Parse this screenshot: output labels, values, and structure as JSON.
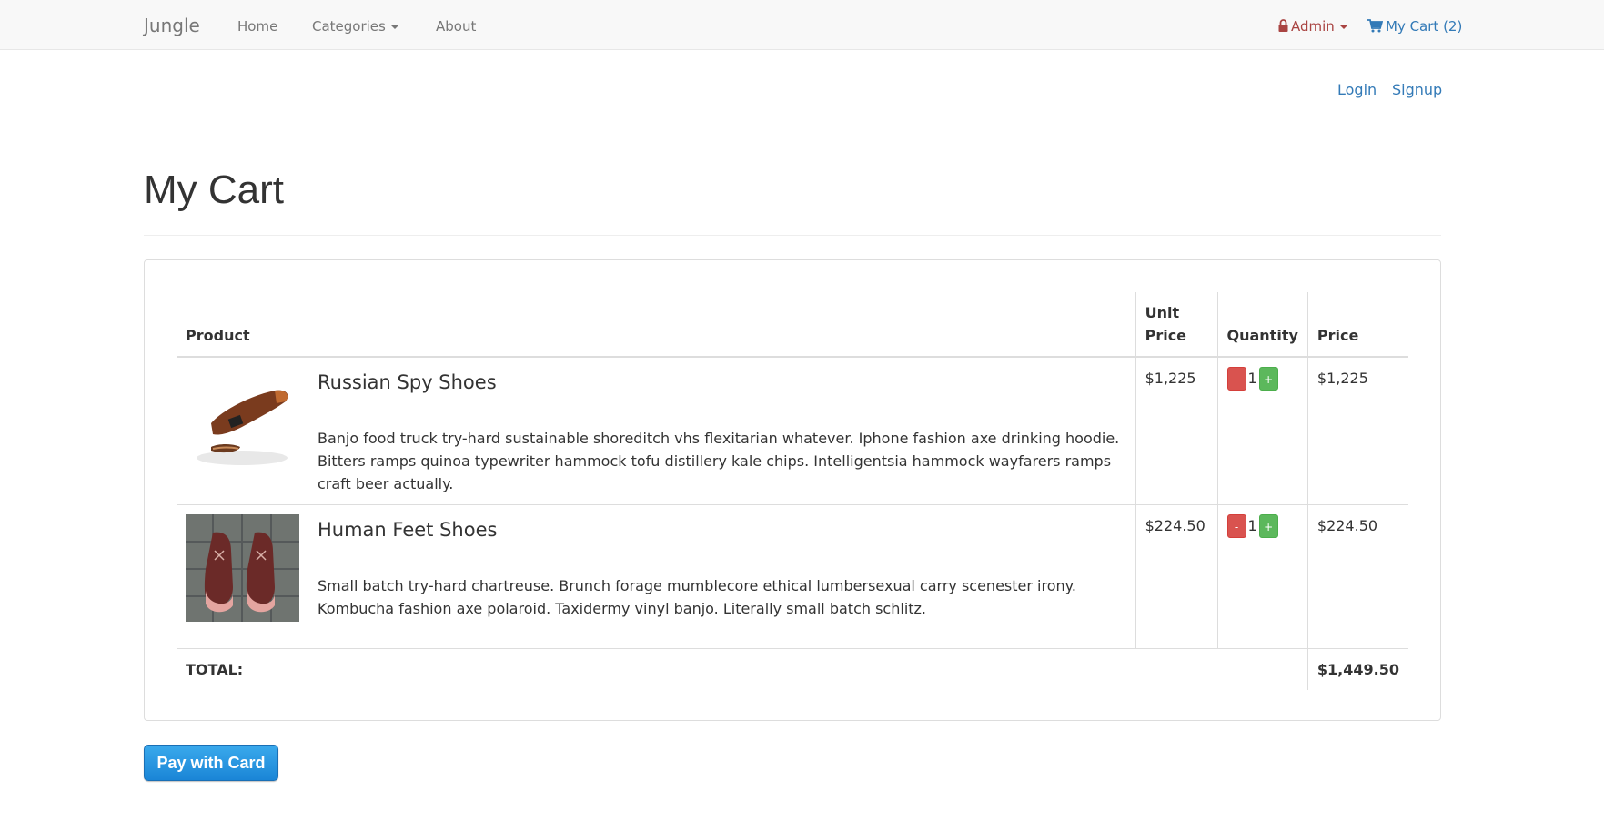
{
  "nav": {
    "brand": "Jungle",
    "home": "Home",
    "categories": "Categories",
    "about": "About",
    "admin": "Admin",
    "cart": "My Cart (2)"
  },
  "auth": {
    "login": "Login",
    "signup": "Signup"
  },
  "page": {
    "title": "My Cart"
  },
  "table": {
    "headers": {
      "product": "Product",
      "unit_price": "Unit Price",
      "quantity": "Quantity",
      "price": "Price"
    },
    "rows": [
      {
        "name": "Russian Spy Shoes",
        "description": "Banjo food truck try-hard sustainable shoreditch vhs flexitarian whatever. Iphone fashion axe drinking hoodie. Bitters ramps quinoa typewriter hammock tofu distillery kale chips. Intelligentsia hammock wayfarers ramps craft beer actually.",
        "unit_price": "$1,225",
        "quantity": "1",
        "price": "$1,225"
      },
      {
        "name": "Human Feet Shoes",
        "description": "Small batch try-hard chartreuse. Brunch forage mumblecore ethical lumbersexual carry scenester irony. Kombucha fashion axe polaroid. Taxidermy vinyl banjo. Literally small batch schlitz.",
        "unit_price": "$224.50",
        "quantity": "1",
        "price": "$224.50"
      }
    ],
    "minus_label": "-",
    "plus_label": "+",
    "total_label": "TOTAL:",
    "total_value": "$1,449.50"
  },
  "pay_button": "Pay with Card",
  "colors": {
    "link": "#337ab7",
    "admin": "#a94442",
    "danger": "#d9534f",
    "success": "#5cb85c",
    "pay": "#1a85d6"
  }
}
